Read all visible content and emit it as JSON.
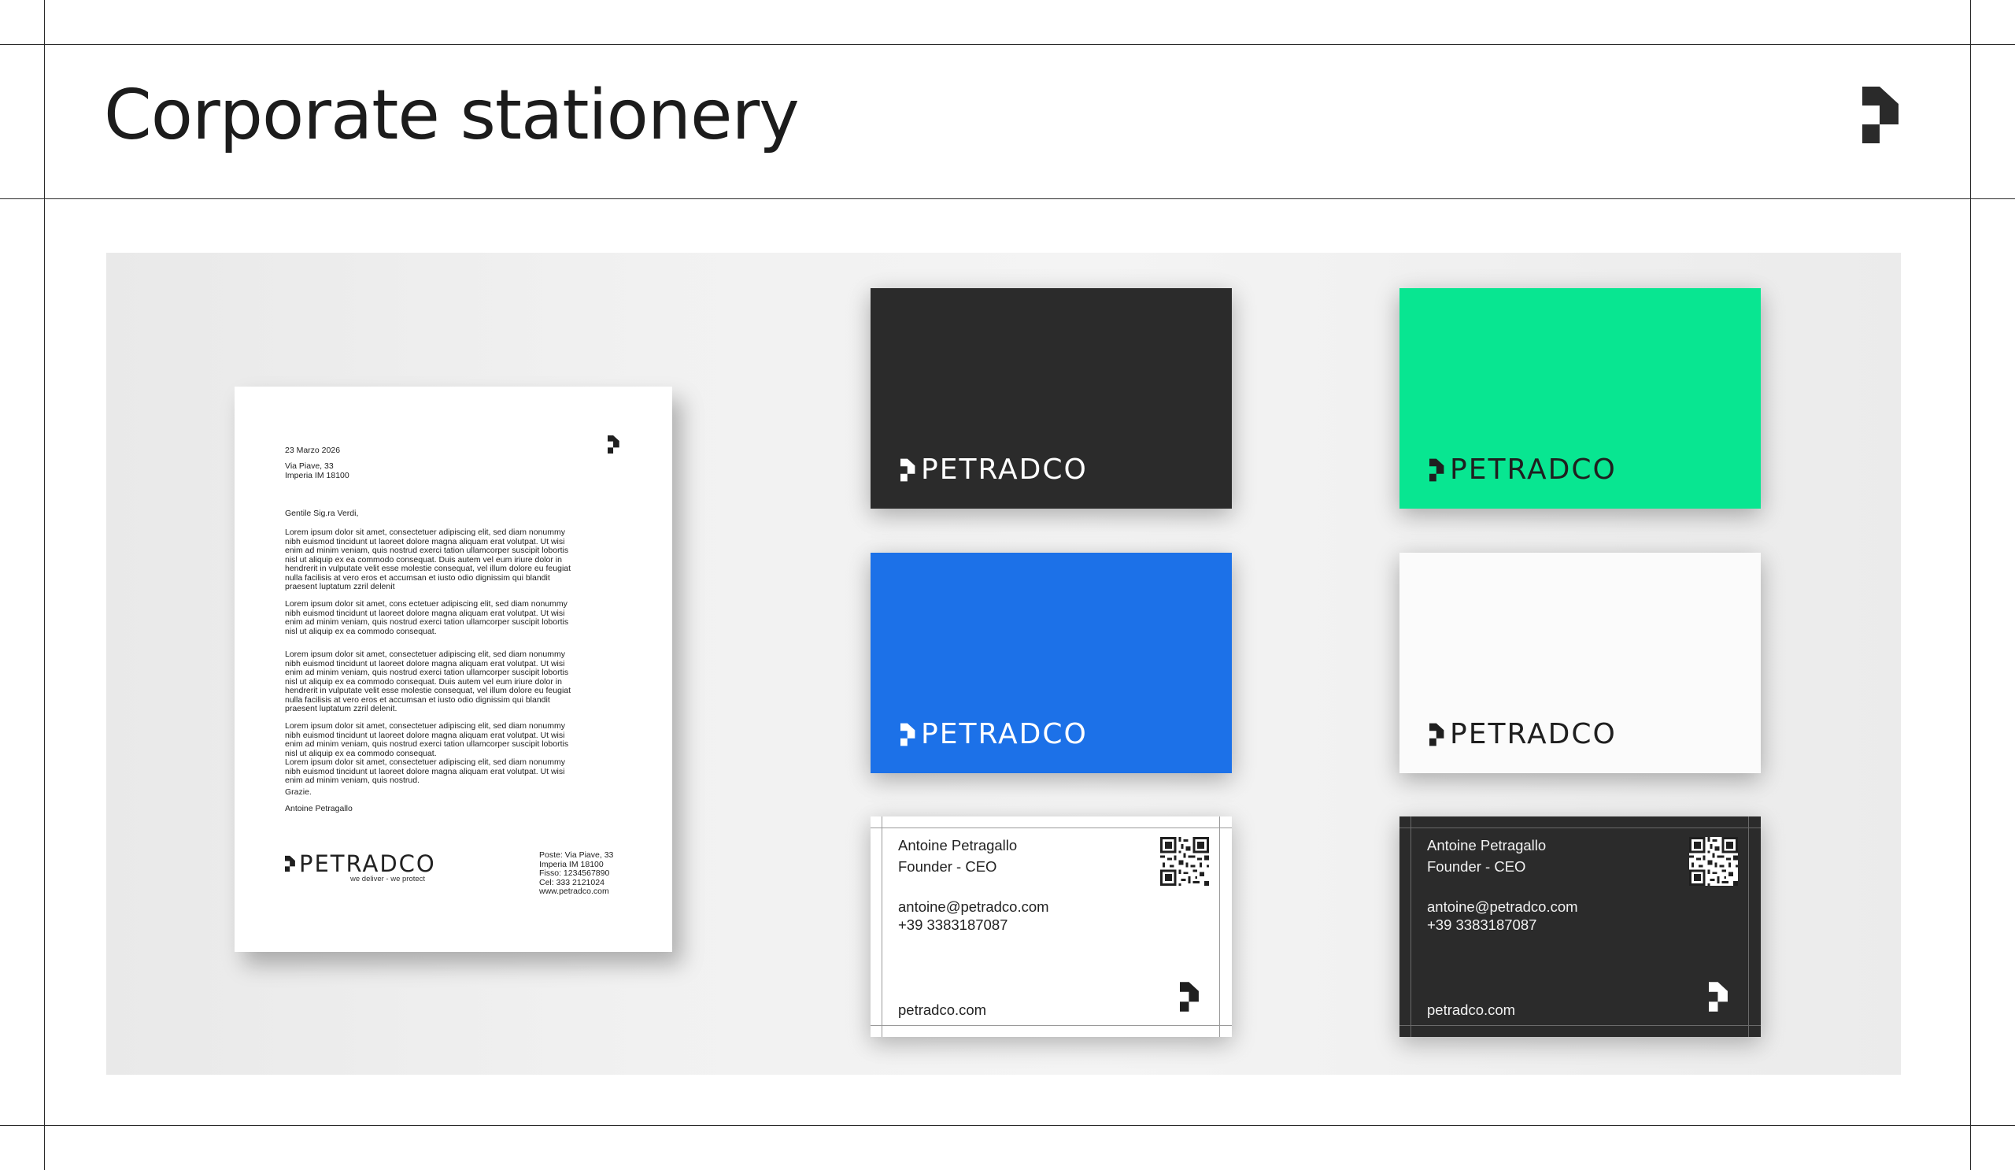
{
  "page": {
    "title": "Corporate stationery"
  },
  "colors": {
    "dark": "#2b2b2b",
    "green": "#08e691",
    "blue": "#1c71e8",
    "white": "#fbfbfb"
  },
  "icons": {
    "brand": "petradco-p-mark-icon",
    "qr": "qr-code-icon"
  },
  "letter": {
    "date": "23 Marzo 2026",
    "address": "Via Piave, 33\nImperia IM 18100",
    "greeting": "Gentile Sig.ra Verdi,",
    "paragraph_1": "Lorem ipsum dolor sit amet, consectetuer adipiscing elit, sed diam nonummy\nnibh euismod tincidunt ut laoreet dolore magna aliquam erat volutpat. Ut wisi\nenim ad minim veniam, quis nostrud exerci tation ullamcorper suscipit lobortis\nnisl ut aliquip ex ea commodo consequat. Duis autem vel eum iriure dolor in\nhendrerit in vulputate velit esse molestie consequat, vel illum dolore eu feugiat\nnulla facilisis at vero eros et accumsan et iusto odio dignissim qui blandit\npraesent luptatum zzril delenit",
    "paragraph_2": "Lorem ipsum dolor sit amet, cons ectetuer adipiscing elit, sed diam nonummy\nnibh euismod tincidunt ut laoreet dolore magna aliquam erat volutpat. Ut wisi\nenim ad minim veniam, quis nostrud exerci tation ullamcorper suscipit lobortis\nnisl ut aliquip ex ea commodo consequat.",
    "paragraph_3": "Lorem ipsum dolor sit amet, consectetuer adipiscing elit, sed diam nonummy\nnibh euismod tincidunt ut laoreet dolore magna aliquam erat volutpat. Ut wisi\nenim ad minim veniam, quis nostrud exerci tation ullamcorper suscipit lobortis\nnisl ut aliquip ex ea commodo consequat. Duis autem vel eum iriure dolor in\nhendrerit in vulputate velit esse molestie consequat, vel illum dolore eu feugiat\nnulla facilisis at vero eros et accumsan et iusto odio dignissim qui blandit\npraesent luptatum zzril delenit.",
    "paragraph_4": "Lorem ipsum dolor sit amet, consectetuer adipiscing elit, sed diam nonummy\nnibh euismod tincidunt ut laoreet dolore magna aliquam erat volutpat. Ut wisi\nenim ad minim veniam, quis nostrud exerci tation ullamcorper suscipit lobortis\nnisl ut aliquip ex ea commodo consequat.\nLorem ipsum dolor sit amet, consectetuer adipiscing elit, sed diam nonummy\nnibh euismod tincidunt ut laoreet dolore magna aliquam erat volutpat. Ut wisi\nenim ad minim veniam, quis nostrud.",
    "thanks": "Grazie.",
    "signature": "Antoine Petragallo",
    "logo_word": "PETRADCO",
    "tagline": "we deliver - we protect",
    "contacts": "Poste: Via Piave, 33\nImperia IM 18100\nFisso: 1234567890\nCel: 333 2121024\nwww.petradco.com"
  },
  "cards": {
    "dark_logo": "PETRADCO",
    "green_logo": "PETRADCO",
    "blue_logo": "PETRADCO",
    "white_logo": "PETRADCO"
  },
  "business_card_light": {
    "name": "Antoine Petragallo",
    "role": "Founder - CEO",
    "email": "antoine@petradco.com",
    "phone": "+39 3383187087",
    "site": "petradco.com"
  },
  "business_card_dark": {
    "name": "Antoine Petragallo",
    "role": "Founder - CEO",
    "email": "antoine@petradco.com",
    "phone": "+39 3383187087",
    "site": "petradco.com"
  }
}
